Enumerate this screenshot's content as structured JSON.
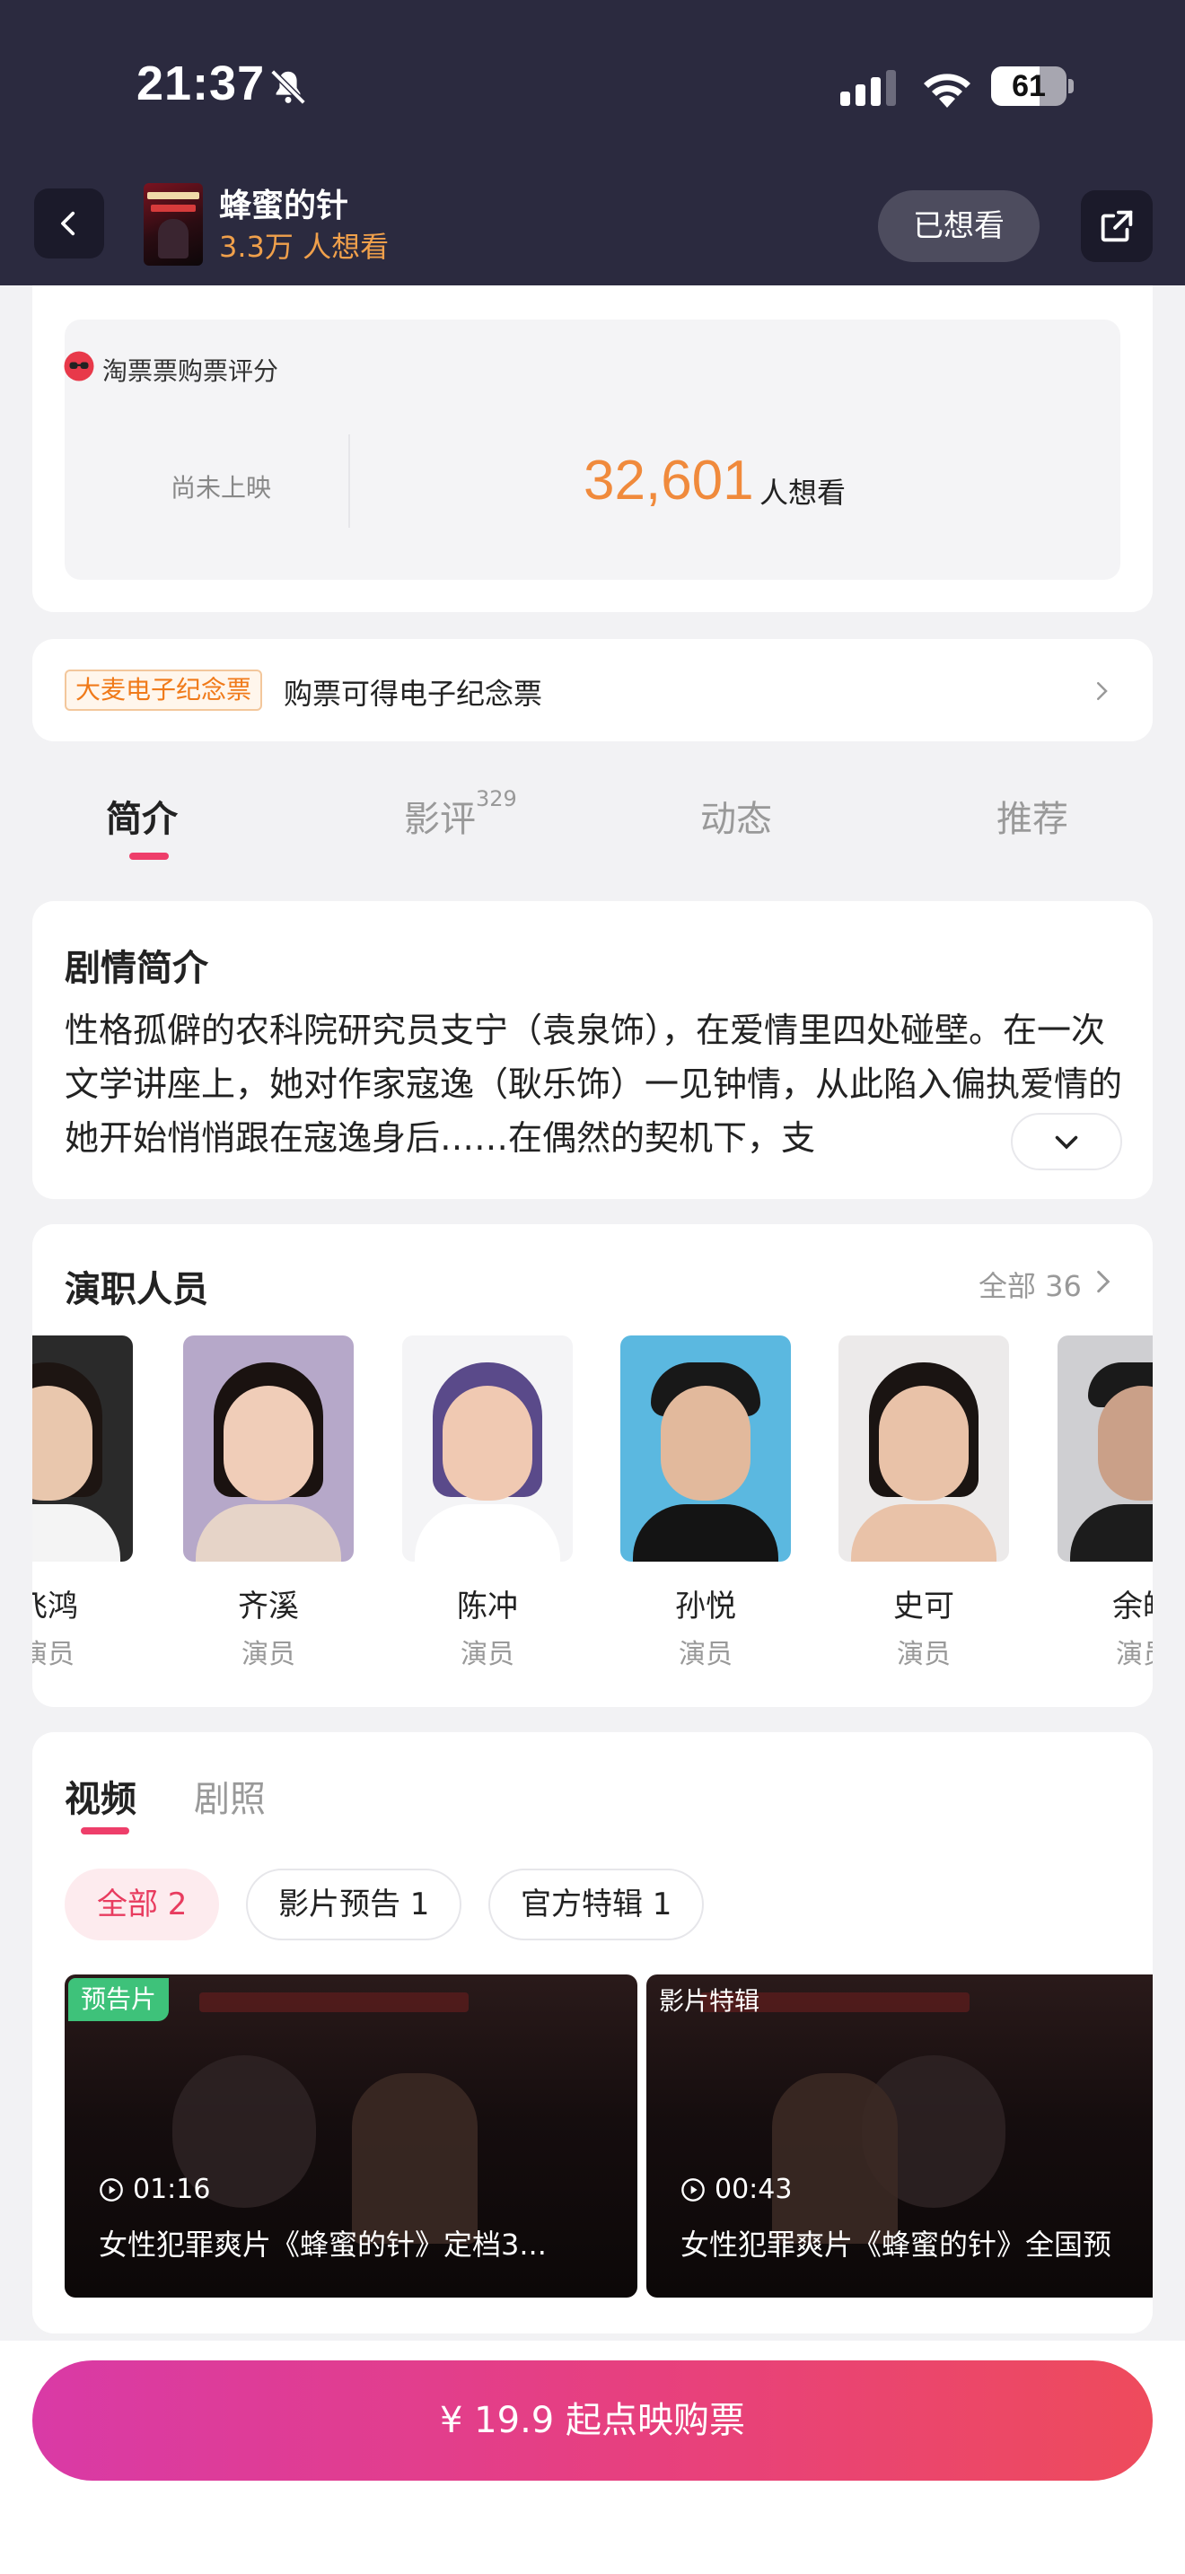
{
  "status_bar": {
    "time": "21:37",
    "battery": "61",
    "icons": [
      "bell-off-icon",
      "signal-icon",
      "wifi-icon",
      "battery-icon"
    ]
  },
  "header": {
    "title": "蜂蜜的针",
    "want_count": "3.3万 人想看",
    "wanted_button": "已想看",
    "back_icon": "chevron-left-icon",
    "share_icon": "share-icon"
  },
  "rating": {
    "brand": "淘票票购票评分",
    "status": "尚未上映",
    "count": "32,601",
    "unit": "人想看"
  },
  "souvenir": {
    "tag": "大麦电子纪念票",
    "text": "购票可得电子纪念票"
  },
  "tabs": [
    {
      "label": "简介",
      "count": ""
    },
    {
      "label": "影评",
      "count": "329"
    },
    {
      "label": "动态",
      "count": ""
    },
    {
      "label": "推荐",
      "count": ""
    }
  ],
  "synopsis": {
    "title": "剧情简介",
    "text": "性格孤僻的农科院研究员支宁（袁泉饰），在爱情里四处碰壁。在一次文学讲座上，她对作家寇逸（耿乐饰）一见钟情，从此陷入偏执爱情的她开始悄悄跟在寇逸身后……在偶然的契机下，支"
  },
  "cast": {
    "title": "演职人员",
    "all_label": "全部 36",
    "members": [
      {
        "name": "飞鸿",
        "role": "演员"
      },
      {
        "name": "齐溪",
        "role": "演员"
      },
      {
        "name": "陈冲",
        "role": "演员"
      },
      {
        "name": "孙悦",
        "role": "演员"
      },
      {
        "name": "史可",
        "role": "演员"
      },
      {
        "name": "余皑",
        "role": "演员"
      }
    ]
  },
  "videos": {
    "tabs": [
      "视频",
      "剧照"
    ],
    "filters": [
      "全部 2",
      "影片预告 1",
      "官方特辑 1"
    ],
    "items": [
      {
        "badge": "预告片",
        "duration": "01:16",
        "caption": "女性犯罪爽片《蜂蜜的针》定档3..."
      },
      {
        "badge": "影片特辑",
        "duration": "00:43",
        "caption": "女性犯罪爽片《蜂蜜的针》全国预"
      }
    ]
  },
  "buy_button": "¥ 19.9 起点映购票",
  "colors": {
    "header_bg": "#2b2a3f",
    "accent_orange": "#f08a3c",
    "accent_pink": "#ee3e6a",
    "buy_gradient_start": "#d93aa6",
    "buy_gradient_end": "#ee4b5c"
  }
}
